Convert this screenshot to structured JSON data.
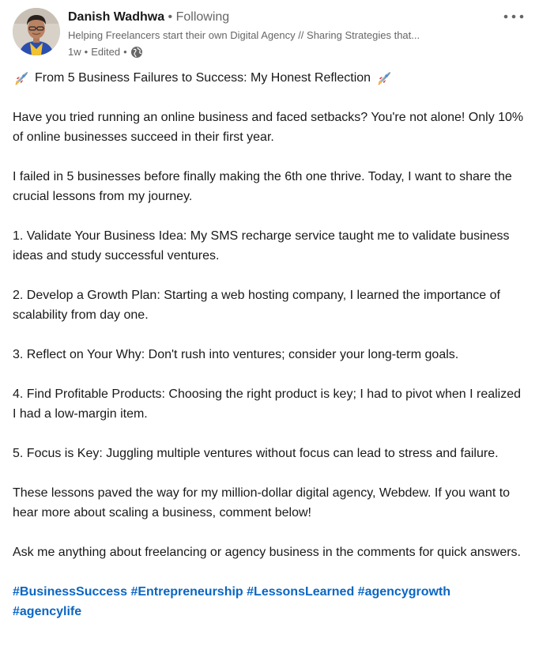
{
  "post": {
    "author": {
      "name": "Danish Wadhwa",
      "separator": "•",
      "follow_status": "Following",
      "headline": "Helping Freelancers start their own Digital Agency // Sharing Strategies that...",
      "time": "1w",
      "edited": "Edited",
      "visibility_icon": "globe-icon"
    },
    "menu_icon": "more-horizontal-icon",
    "title": "From 5 Business Failures to Success: My Honest Reflection",
    "paragraphs": [
      "Have you tried running an online business and faced setbacks? You're not alone! Only 10% of online businesses succeed in their first year.",
      "I failed in 5 businesses before finally making the 6th one thrive. Today, I want to share the crucial lessons from my journey.",
      "1. Validate Your Business Idea: My SMS recharge service taught me to validate business ideas and study successful ventures.",
      "2. Develop a Growth Plan: Starting a web hosting company, I learned the importance of scalability from day one.",
      "3. Reflect on Your Why: Don't rush into ventures; consider your long-term goals.",
      "4. Find Profitable Products: Choosing the right product is key; I had to pivot when I realized I had a low-margin item.",
      "5. Focus is Key: Juggling multiple ventures without focus can lead to stress and failure.",
      "These lessons paved the way for my million-dollar digital agency, Webdew. If you want to hear more about scaling a business, comment below!",
      "Ask me anything about freelancing or agency business in the comments for quick answers."
    ],
    "hashtags": [
      "#BusinessSuccess",
      "#Entrepreneurship",
      "#LessonsLearned",
      "#agencygrowth",
      "#agencylife"
    ],
    "colors": {
      "link": "#0a66c2",
      "muted": "#666666",
      "text": "#191919"
    }
  }
}
